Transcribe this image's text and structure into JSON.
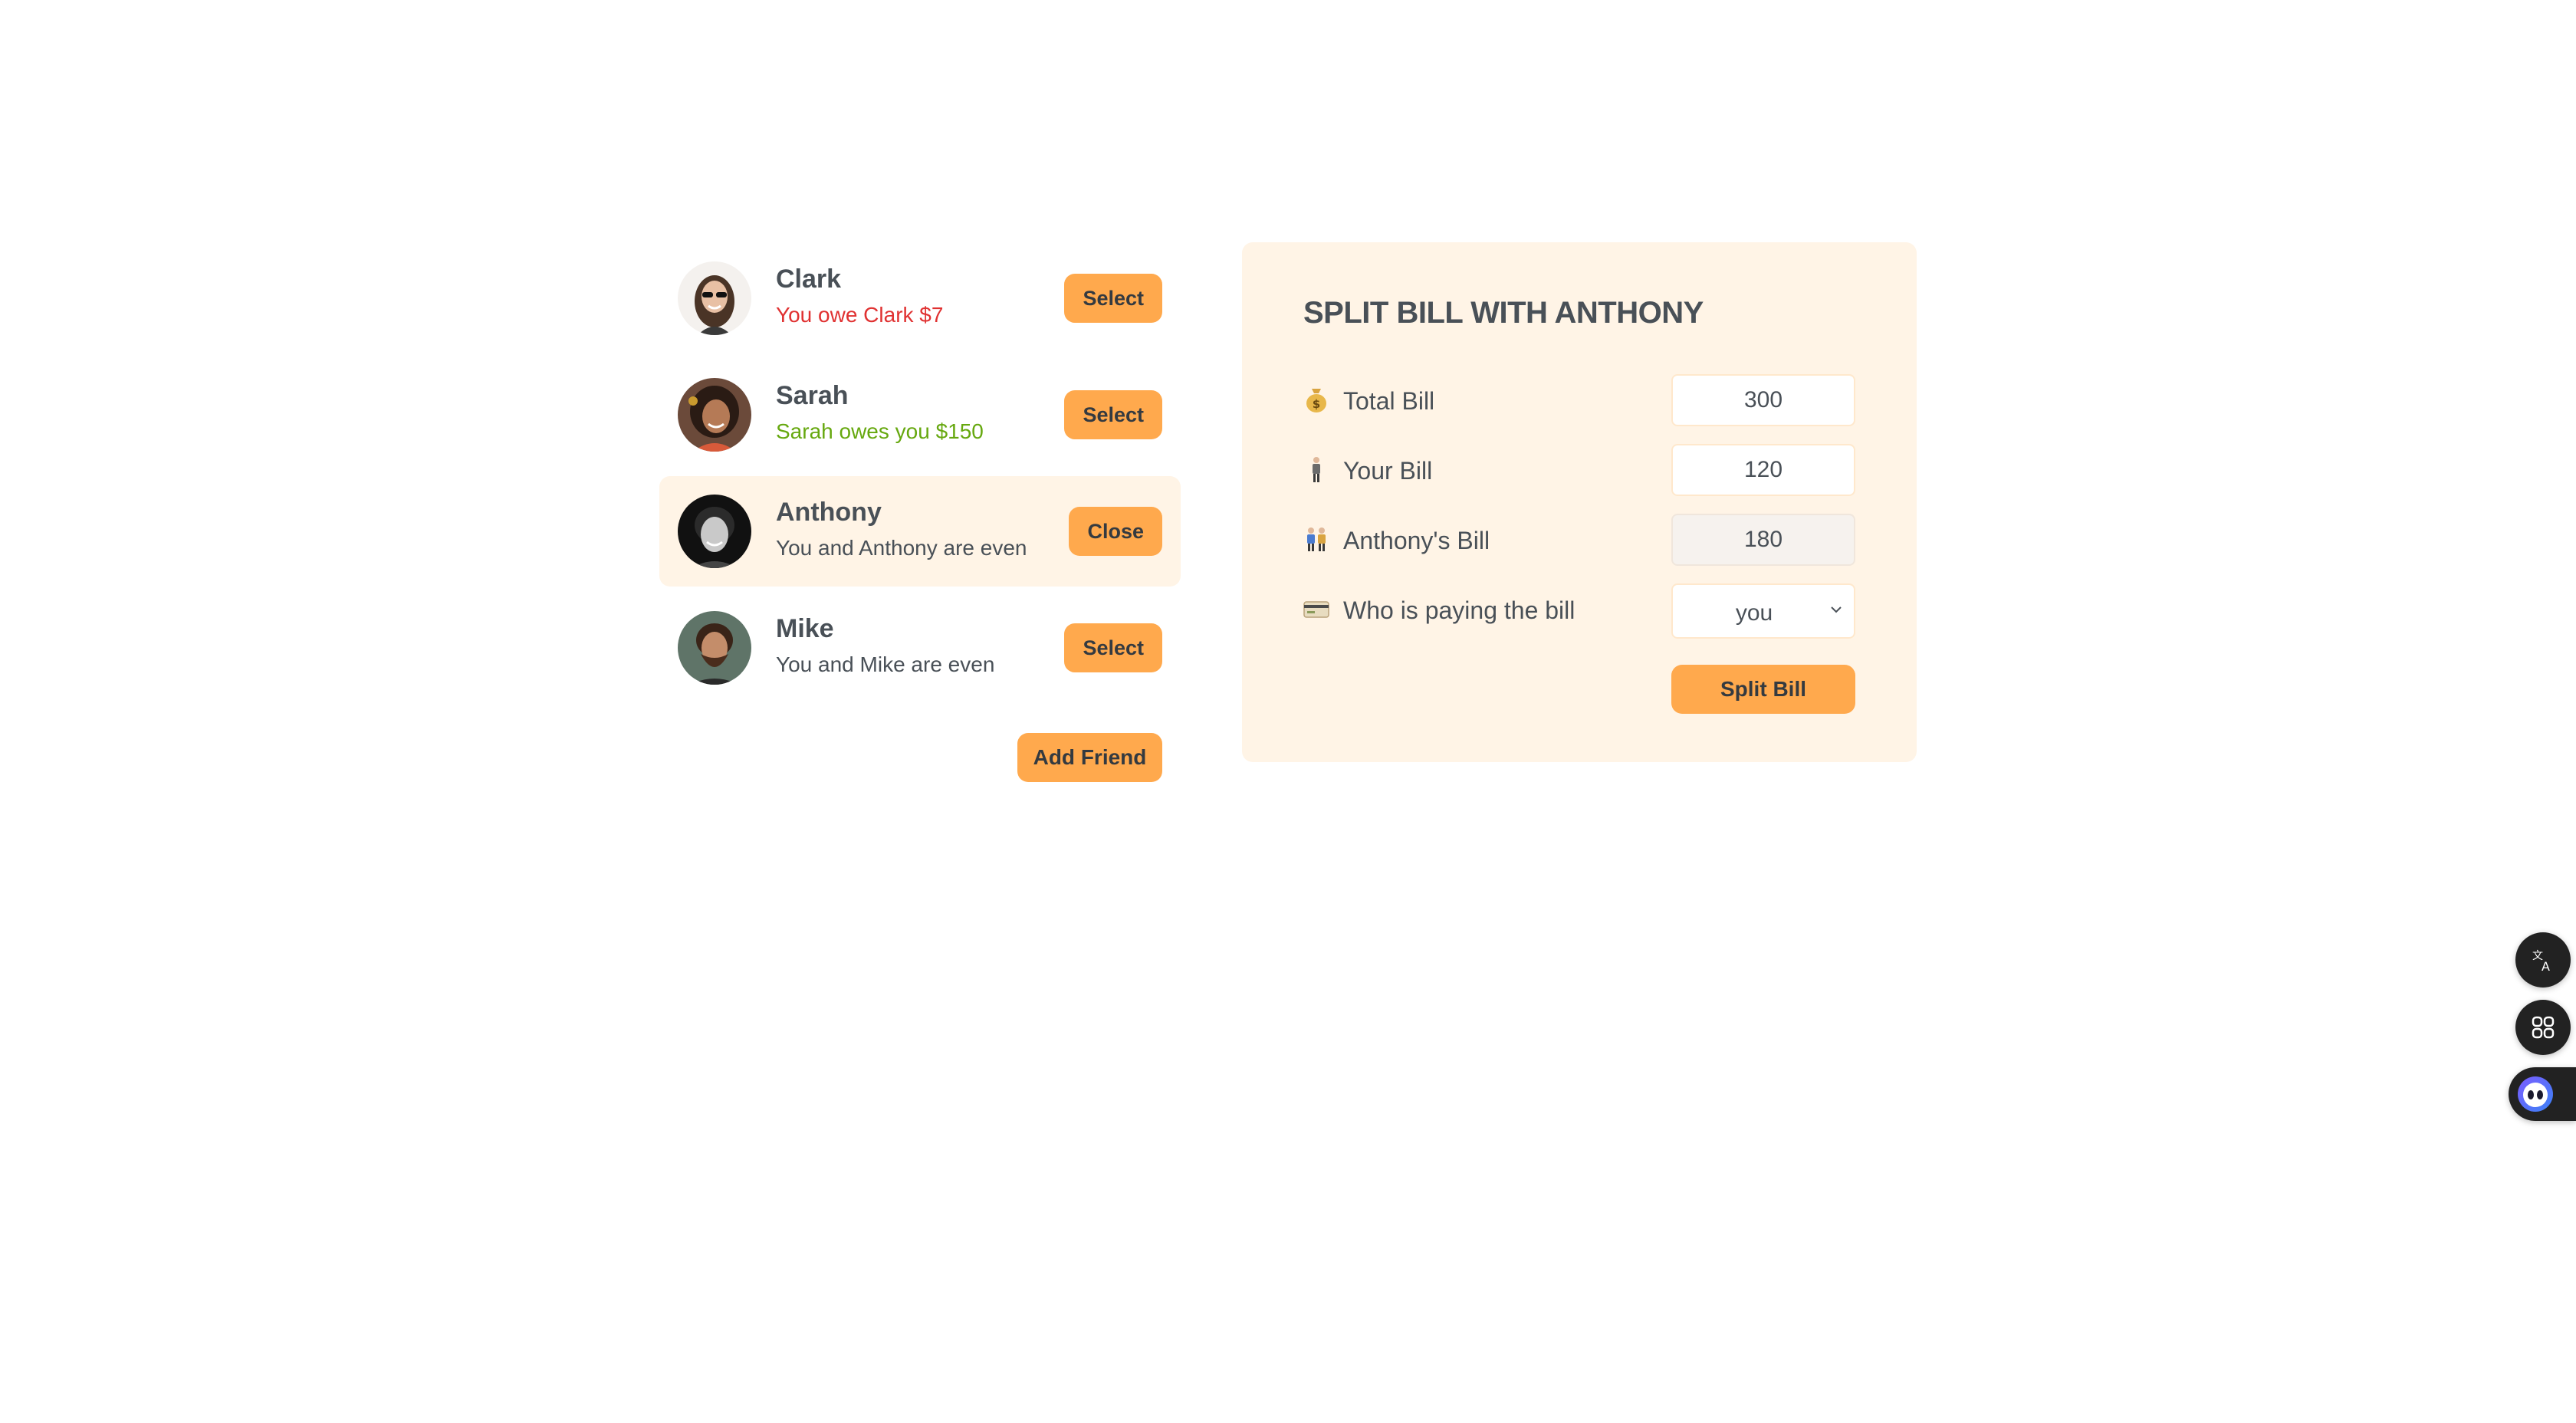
{
  "friends": [
    {
      "name": "Clark",
      "status": "You owe Clark $7",
      "status_type": "owe",
      "button": "Select",
      "selected": false
    },
    {
      "name": "Sarah",
      "status": "Sarah owes you $150",
      "status_type": "owed",
      "button": "Select",
      "selected": false
    },
    {
      "name": "Anthony",
      "status": "You and Anthony are even",
      "status_type": "even",
      "button": "Close",
      "selected": true
    },
    {
      "name": "Mike",
      "status": "You and Mike are even",
      "status_type": "even",
      "button": "Select",
      "selected": false
    }
  ],
  "add_friend_label": "Add Friend",
  "split": {
    "title": "SPLIT BILL WITH ANTHONY",
    "total_label": "Total Bill",
    "total_value": "300",
    "your_label": "Your Bill",
    "your_value": "120",
    "friend_label": "Anthony's Bill",
    "friend_value": "180",
    "payer_label": "Who is paying the bill",
    "payer_value": "you",
    "submit_label": "Split Bill"
  },
  "colors": {
    "accent": "#ffa94d",
    "panel_bg": "#fff4e6",
    "owe": "#e03131",
    "owed": "#66a80f",
    "text": "#495057"
  },
  "icons": {
    "total": "money-bag-icon",
    "your": "person-standing-icon",
    "friend": "two-people-icon",
    "payer": "credit-card-icon",
    "fab1": "translate-icon",
    "fab2": "grid-apps-icon",
    "fab3": "assistant-face-icon"
  }
}
